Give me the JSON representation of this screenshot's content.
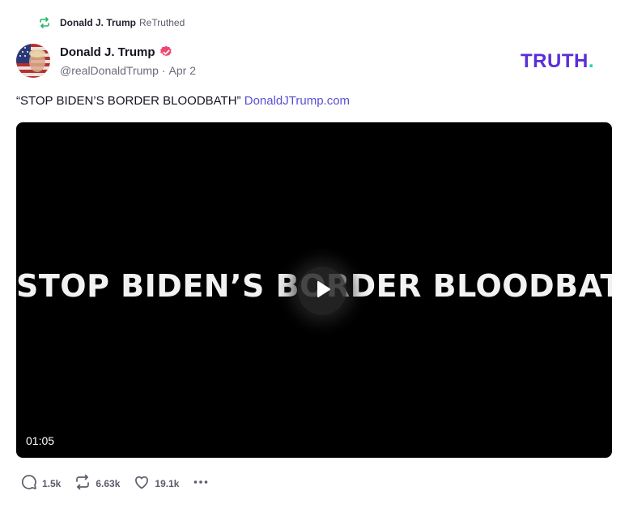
{
  "retruth": {
    "name": "Donald J. Trump",
    "suffix": "ReTruthed",
    "icon": "retruth-icon",
    "color": "#23b566"
  },
  "post": {
    "author": {
      "display_name": "Donald J. Trump",
      "handle": "@realDonaldTrump",
      "separator": "·",
      "date": "Apr 2",
      "verified_icon": "verified-badge-icon",
      "verified_color": "#f04770"
    },
    "text": "“STOP BIDEN’S BORDER BLOODBATH”",
    "link_text": "DonaldJTrump.com",
    "link_color": "#5a4fd6"
  },
  "brand": {
    "logo_text": "TRUTH",
    "logo_dot": ".",
    "logo_color": "#5a2fd8",
    "dot_color": "#19d3b3"
  },
  "video": {
    "title_text": "STOP BIDEN’S BORDER BLOODBATH",
    "duration": "01:05",
    "play_icon": "play-icon"
  },
  "actions": {
    "replies": {
      "icon": "reply-icon",
      "count": "1.5k"
    },
    "retruths": {
      "icon": "retruth-icon",
      "count": "6.63k"
    },
    "likes": {
      "icon": "heart-icon",
      "count": "19.1k"
    },
    "more": {
      "icon": "more-icon"
    }
  }
}
